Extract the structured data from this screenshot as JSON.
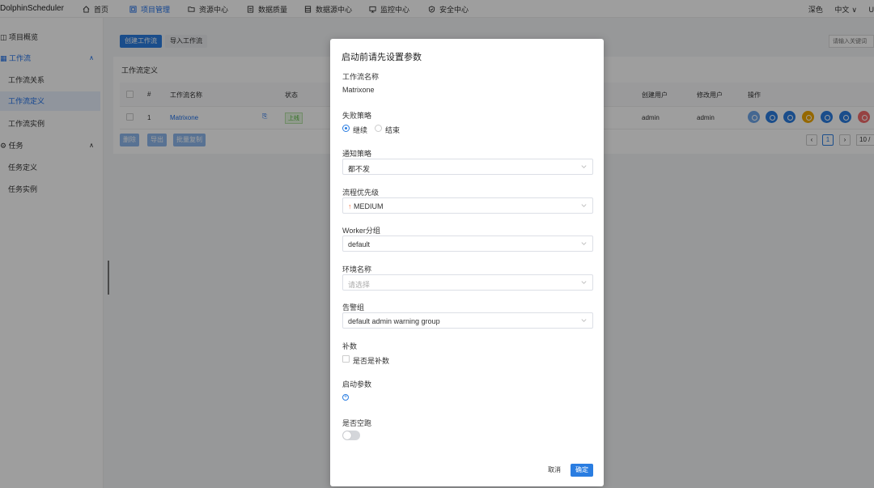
{
  "app": {
    "logo": "DolphinScheduler"
  },
  "nav": [
    {
      "label": "首页",
      "icon": "home-icon"
    },
    {
      "label": "项目管理",
      "icon": "project-icon"
    },
    {
      "label": "资源中心",
      "icon": "folder-icon"
    },
    {
      "label": "数据质量",
      "icon": "quality-icon"
    },
    {
      "label": "数据源中心",
      "icon": "datasource-icon"
    },
    {
      "label": "监控中心",
      "icon": "monitor-icon"
    },
    {
      "label": "安全中心",
      "icon": "shield-icon"
    }
  ],
  "topright": {
    "theme": "深色",
    "lang": "中文",
    "user": "U"
  },
  "sidebar": {
    "items": [
      {
        "label": "项目概览"
      },
      {
        "label": "工作流"
      },
      {
        "label": "工作流关系"
      },
      {
        "label": "工作流定义"
      },
      {
        "label": "工作流实例"
      },
      {
        "label": "任务"
      },
      {
        "label": "任务定义"
      },
      {
        "label": "任务实例"
      }
    ]
  },
  "toolbar": {
    "create": "创建工作流",
    "import": "导入工作流",
    "search_placeholder": "请输入关键词"
  },
  "card": {
    "title": "工作流定义"
  },
  "table": {
    "headers": {
      "index": "#",
      "name": "工作流名称",
      "status": "状态",
      "creator": "创建用户",
      "modifier": "修改用户",
      "ops": "操作"
    },
    "row": {
      "index": "1",
      "name": "Matrixone",
      "status": "上线",
      "creator": "admin",
      "modifier": "admin"
    }
  },
  "bulk": {
    "delete": "删除",
    "export": "导出",
    "copy": "批量复制"
  },
  "pager": {
    "page": "1",
    "size": "10 /"
  },
  "modal": {
    "title": "启动前请先设置参数",
    "name_label": "工作流名称",
    "name_value": "Matrixone",
    "fail_label": "失败策略",
    "fail_continue": "继续",
    "fail_end": "结束",
    "notify_label": "通知策略",
    "notify_value": "都不发",
    "priority_label": "流程优先级",
    "priority_value": "MEDIUM",
    "worker_label": "Worker分组",
    "worker_value": "default",
    "env_label": "环境名称",
    "env_placeholder": "请选择",
    "alert_label": "告警组",
    "alert_value": "default admin warning group",
    "complement_label": "补数",
    "complement_check": "是否是补数",
    "startup_label": "启动参数",
    "dry_label": "是否空跑",
    "cancel": "取消",
    "confirm": "确定"
  },
  "colors": {
    "primary": "#2a7de1",
    "ops": [
      "#6fa6ea",
      "#2a7de1",
      "#2a7de1",
      "#f1a800",
      "#2a7de1",
      "#2a7de1",
      "#f26b6b"
    ]
  }
}
